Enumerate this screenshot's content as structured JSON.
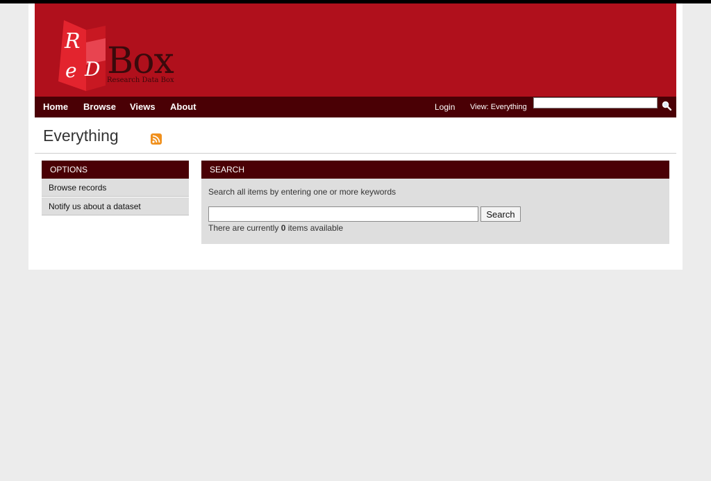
{
  "brand": {
    "logo_text": "Box",
    "logo_sub": "Research Data Box",
    "logo_letters": "ReD"
  },
  "nav": {
    "items": [
      {
        "label": "Home"
      },
      {
        "label": "Browse"
      },
      {
        "label": "Views"
      },
      {
        "label": "About"
      }
    ],
    "login_label": "Login",
    "view_label": "View: Everything",
    "search_placeholder": ""
  },
  "page": {
    "title": "Everything"
  },
  "options": {
    "heading": "OPTIONS",
    "items": [
      {
        "label": "Browse records"
      },
      {
        "label": "Notify us about a dataset"
      }
    ]
  },
  "search": {
    "heading": "SEARCH",
    "description": "Search all items by entering one or more keywords",
    "input_value": "",
    "button_label": "Search",
    "count_prefix": "There are currently",
    "count_value": "0",
    "count_suffix": "items available"
  },
  "colors": {
    "header": "#b0101c",
    "nav": "#4a0005",
    "panel": "#dedede",
    "rss": "#f0901d"
  },
  "icons": {
    "rss": "rss-feed-icon",
    "search": "magnifier-icon"
  }
}
